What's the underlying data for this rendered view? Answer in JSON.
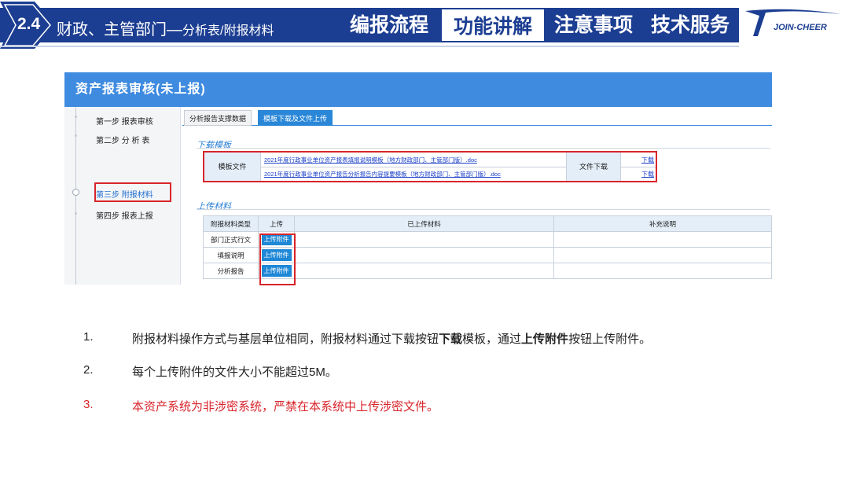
{
  "header": {
    "section_num": "2.4",
    "title_main": "财政、主管部门—",
    "title_sub": "分析表/附报材料",
    "nav": [
      "编报流程",
      "功能讲解",
      "注意事项",
      "技术服务"
    ],
    "active_nav": "功能讲解",
    "logo_text": "JOIN-CHEER"
  },
  "colors": {
    "brand": "#1c3e92",
    "accent": "#3f8be0",
    "alert": "#d8252b",
    "link": "#1a3fc8"
  },
  "app": {
    "title": "资产报表审核(未上报)",
    "steps": [
      "第一步 报表审核",
      "第二步 分 析 表",
      "第三步 附报材料",
      "第四步 报表上报"
    ],
    "active_step": 2,
    "tabs": [
      "分析报告支撑数据",
      "模板下载及文件上传"
    ],
    "active_tab": 1,
    "download_section": {
      "title": "下载模板",
      "label": "模板文件",
      "files": [
        "2021年度行政事业单位资产报表填报说明模板（地方财政部门、主管部门版）.doc",
        "2021年度行政事业单位资产报告分析报告内容提要模板（地方财政部门、主管部门版）.doc"
      ],
      "download_label": "文件下载",
      "download_link": "下载"
    },
    "upload_section": {
      "title": "上传材料",
      "columns": [
        "附报材料类型",
        "上传",
        "已上传材料",
        "补充说明"
      ],
      "rows": [
        {
          "type": "部门正式行文",
          "button": "上传附件"
        },
        {
          "type": "填报说明",
          "button": "上传附件"
        },
        {
          "type": "分析报告",
          "button": "上传附件"
        }
      ]
    }
  },
  "notes": [
    {
      "num": "1.",
      "parts": [
        {
          "text": "附报材料操作方式与基层单位相同，附报材料通过下载按钮",
          "bold": false
        },
        {
          "text": "下载",
          "bold": true
        },
        {
          "text": "模板，通过",
          "bold": false
        },
        {
          "text": "上传附件",
          "bold": true
        },
        {
          "text": "按钮上传附件。",
          "bold": false
        }
      ]
    },
    {
      "num": "2.",
      "parts": [
        {
          "text": "每个上传附件的文件大小不能超过5M。",
          "bold": false
        }
      ]
    },
    {
      "num": "3.",
      "parts": [
        {
          "text": "本资产系统为非涉密系统，严禁在本系统中上传涉密文件。",
          "bold": false
        }
      ],
      "red": true
    }
  ]
}
